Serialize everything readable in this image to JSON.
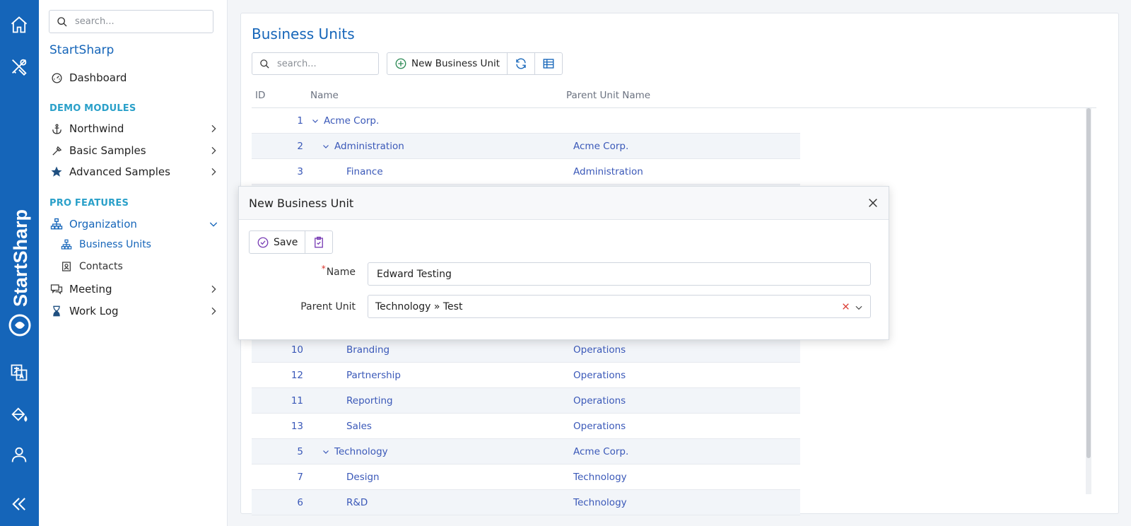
{
  "rail": {
    "brand_text": "StartSharp",
    "icons": [
      "home-icon",
      "tools-icon",
      "translate-icon",
      "theme-icon",
      "user-icon",
      "collapse-icon"
    ]
  },
  "sidebar": {
    "search_placeholder": "search...",
    "app_title": "StartSharp",
    "dashboard": "Dashboard",
    "section_demo": "DEMO MODULES",
    "northwind": "Northwind",
    "basic_samples": "Basic Samples",
    "advanced_samples": "Advanced Samples",
    "section_pro": "PRO FEATURES",
    "organization": "Organization",
    "business_units": "Business Units",
    "contacts": "Contacts",
    "meeting": "Meeting",
    "work_log": "Work Log"
  },
  "main": {
    "title": "Business Units",
    "search_placeholder": "search...",
    "new_button": "New Business Unit",
    "columns": {
      "id": "ID",
      "name": "Name",
      "parent": "Parent Unit Name"
    },
    "rows": [
      {
        "id": "1",
        "name": "Acme Corp.",
        "parent": "",
        "level": 0,
        "expand": true
      },
      {
        "id": "2",
        "name": "Administration",
        "parent": "Acme Corp.",
        "level": 1,
        "expand": true
      },
      {
        "id": "3",
        "name": "Finance",
        "parent": "Administration",
        "level": 2,
        "expand": false
      },
      {
        "id": "",
        "name": "",
        "parent": "",
        "level": 2,
        "expand": false
      },
      {
        "id": "",
        "name": "",
        "parent": "",
        "level": 2,
        "expand": false
      },
      {
        "id": "",
        "name": "",
        "parent": "",
        "level": 2,
        "expand": false
      },
      {
        "id": "",
        "name": "",
        "parent": "",
        "level": 2,
        "expand": false
      },
      {
        "id": "",
        "name": "",
        "parent": "",
        "level": 2,
        "expand": false
      },
      {
        "id": "",
        "name": "",
        "parent": "",
        "level": 2,
        "expand": false
      },
      {
        "id": "10",
        "name": "Branding",
        "parent": "Operations",
        "level": 2,
        "expand": false
      },
      {
        "id": "12",
        "name": "Partnership",
        "parent": "Operations",
        "level": 2,
        "expand": false
      },
      {
        "id": "11",
        "name": "Reporting",
        "parent": "Operations",
        "level": 2,
        "expand": false
      },
      {
        "id": "13",
        "name": "Sales",
        "parent": "Operations",
        "level": 2,
        "expand": false
      },
      {
        "id": "5",
        "name": "Technology",
        "parent": "Acme Corp.",
        "level": 1,
        "expand": true
      },
      {
        "id": "7",
        "name": "Design",
        "parent": "Technology",
        "level": 2,
        "expand": false
      },
      {
        "id": "6",
        "name": "R&D",
        "parent": "Technology",
        "level": 2,
        "expand": false
      }
    ]
  },
  "dialog": {
    "title": "New Business Unit",
    "save_label": "Save",
    "name_label": "Name",
    "name_value": "Edward Testing",
    "parent_label": "Parent Unit",
    "parent_value": "Technology » Test"
  },
  "colors": {
    "rail": "#1565b9",
    "accent": "#1565b9",
    "link": "#3a58b8",
    "section": "#2aa0c9",
    "required": "#d9342b"
  }
}
